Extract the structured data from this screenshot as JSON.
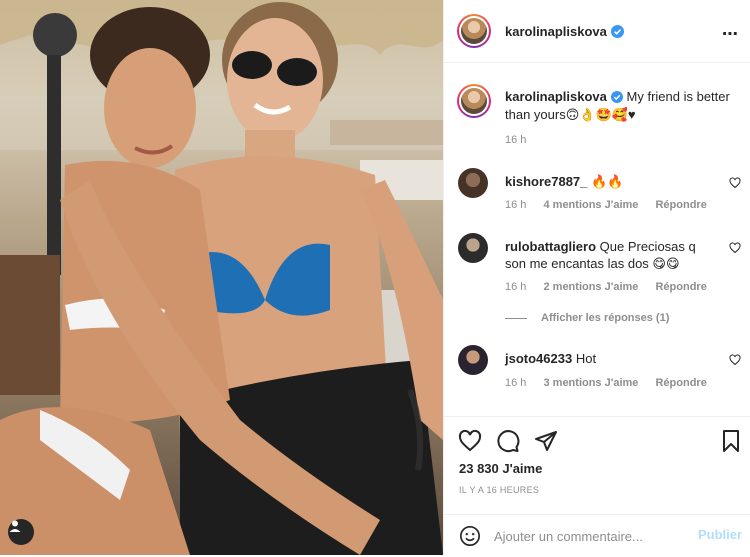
{
  "post": {
    "username": "karolinapliskova",
    "verified": true,
    "caption": "My friend is better than yours",
    "caption_emojis": "🙃👌🤩🥰♥",
    "time": "16 h",
    "likes": "23 830 J'aime",
    "date": "IL Y A 16 HEURES"
  },
  "comments": [
    {
      "user": "kishore7887_",
      "text": "🔥🔥",
      "time": "16 h",
      "likes": "4 mentions J'aime",
      "reply": "Répondre"
    },
    {
      "user": "rulobattagliero",
      "text": "Que Preciosas q son me encantas las dos 😋😋",
      "time": "16 h",
      "likes": "2 mentions J'aime",
      "reply": "Répondre",
      "replies_link": "Afficher les réponses (1)"
    },
    {
      "user": "jsoto46233",
      "text": "Hot",
      "time": "16 h",
      "likes": "3 mentions J'aime",
      "reply": "Répondre"
    }
  ],
  "add_comment": {
    "placeholder": "Ajouter un commentaire...",
    "publish_label": "Publier"
  },
  "icons": {
    "more": "⋯",
    "verified_color": "#3897f0",
    "publish_color": "#b2dffc"
  }
}
